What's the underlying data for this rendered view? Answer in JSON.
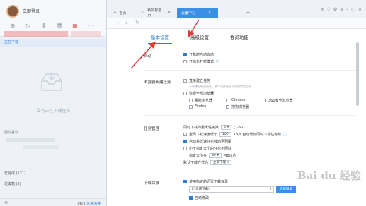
{
  "left_panel": {
    "login_label": "立即登录",
    "active_item": "正在下载",
    "empty_text": "没有正在下载任务",
    "recommend_label": "猜你喜欢",
    "completed": "已完成 (121)",
    "trash": "垃圾箱 (5)",
    "speed_prefix": "0B/s",
    "speed_link": "急速加速"
  },
  "tabs": [
    {
      "label": "首页"
    },
    {
      "label": "新的标签页"
    },
    {
      "label": "设置中心"
    }
  ],
  "settings": {
    "tabs": {
      "basic": "基本设置",
      "advanced": "高级设置",
      "member": "会员功能"
    },
    "startup": {
      "label": "启动",
      "boot_start": "开机时自动启动",
      "free_mode": "开启免打扰模式"
    },
    "browser": {
      "label": "浏览器新建任务",
      "direct": "直接建立任务",
      "direct_hint": "不再弹出新建面板，单个文件直接下载到常用目录",
      "monitor_all": "监视全部浏览器",
      "browsers": [
        "系统浏览器",
        "Chrome",
        "360安全浏览器",
        "Firefox",
        "搜狗浏览器"
      ]
    },
    "tasks": {
      "label": "任务管理",
      "max_tasks_label": "同时下载的最大任务数",
      "max_tasks_value": "5",
      "max_tasks_range": "(1-50)",
      "speed_label": "全局下载速度低于",
      "speed_value": "100",
      "speed_suffix": "KB/s 自动增加同时下载任务数",
      "auto_top": "自动将低速任务移动至列尾",
      "small_task": "小于指定大小的任务不限队",
      "size_label": "指定大小在",
      "size_value": "30",
      "size_unit": "MB以内",
      "default_label": "默认下载方式为",
      "default_value": "立即下载"
    },
    "download_dir": {
      "label": "下载目录",
      "use_dir": "使用指定的迅雷下载目录",
      "path": "F:\\迅雷下载\\",
      "choose_btn": "选择目录",
      "auto_modify": "自动修改"
    }
  },
  "watermark": {
    "text": "Bai du 经验"
  }
}
